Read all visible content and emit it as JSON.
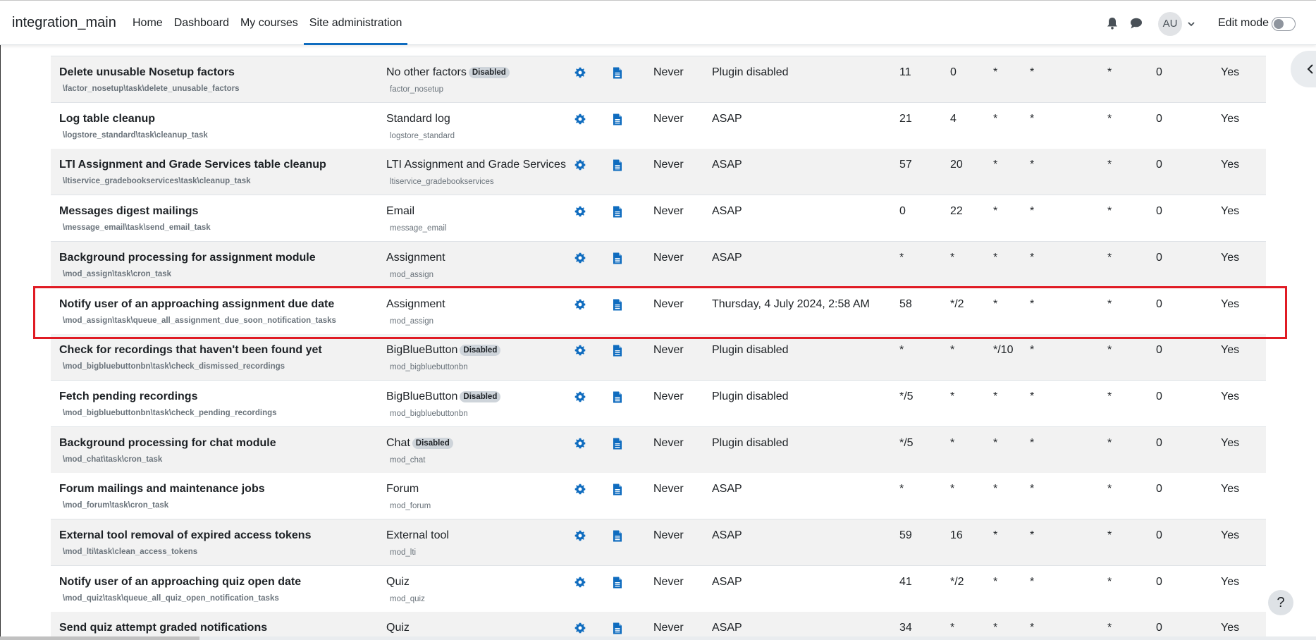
{
  "navbar": {
    "brand": "integration_main",
    "links": [
      "Home",
      "Dashboard",
      "My courses",
      "Site administration"
    ],
    "avatar_initials": "AU",
    "edit_mode_label": "Edit mode"
  },
  "help_label": "?",
  "colors": {
    "accent": "#0f6cbf",
    "highlight": "#e01b24",
    "badge": "#ced4da"
  },
  "rows": [
    {
      "name": "Delete unusable Nosetup factors",
      "classname": "\\factor_nosetup\\task\\delete_unusable_factors",
      "component": "No other factors",
      "badge": "Disabled",
      "plugin": "factor_nosetup",
      "lastrun": "Never",
      "nextrun": "Plugin disabled",
      "minute": "11",
      "hour": "0",
      "day": "*",
      "month": "*",
      "dow": "*",
      "faildelay": "0",
      "default": "Yes"
    },
    {
      "name": "Log table cleanup",
      "classname": "\\logstore_standard\\task\\cleanup_task",
      "component": "Standard log",
      "badge": "",
      "plugin": "logstore_standard",
      "lastrun": "Never",
      "nextrun": "ASAP",
      "minute": "21",
      "hour": "4",
      "day": "*",
      "month": "*",
      "dow": "*",
      "faildelay": "0",
      "default": "Yes"
    },
    {
      "name": "LTI Assignment and Grade Services table cleanup",
      "classname": "\\ltiservice_gradebookservices\\task\\cleanup_task",
      "component": "LTI Assignment and Grade Services",
      "badge": "",
      "plugin": "ltiservice_gradebookservices",
      "lastrun": "Never",
      "nextrun": "ASAP",
      "minute": "57",
      "hour": "20",
      "day": "*",
      "month": "*",
      "dow": "*",
      "faildelay": "0",
      "default": "Yes"
    },
    {
      "name": "Messages digest mailings",
      "classname": "\\message_email\\task\\send_email_task",
      "component": "Email",
      "badge": "",
      "plugin": "message_email",
      "lastrun": "Never",
      "nextrun": "ASAP",
      "minute": "0",
      "hour": "22",
      "day": "*",
      "month": "*",
      "dow": "*",
      "faildelay": "0",
      "default": "Yes"
    },
    {
      "name": "Background processing for assignment module",
      "classname": "\\mod_assign\\task\\cron_task",
      "component": "Assignment",
      "badge": "",
      "plugin": "mod_assign",
      "lastrun": "Never",
      "nextrun": "ASAP",
      "minute": "*",
      "hour": "*",
      "day": "*",
      "month": "*",
      "dow": "*",
      "faildelay": "0",
      "default": "Yes"
    },
    {
      "name": "Notify user of an approaching assignment due date",
      "classname": "\\mod_assign\\task\\queue_all_assignment_due_soon_notification_tasks",
      "component": "Assignment",
      "badge": "",
      "plugin": "mod_assign",
      "lastrun": "Never",
      "nextrun": "Thursday, 4 July 2024, 2:58 AM",
      "minute": "58",
      "hour": "*/2",
      "day": "*",
      "month": "*",
      "dow": "*",
      "faildelay": "0",
      "default": "Yes"
    },
    {
      "name": "Check for recordings that haven't been found yet",
      "classname": "\\mod_bigbluebuttonbn\\task\\check_dismissed_recordings",
      "component": "BigBlueButton",
      "badge": "Disabled",
      "plugin": "mod_bigbluebuttonbn",
      "lastrun": "Never",
      "nextrun": "Plugin disabled",
      "minute": "*",
      "hour": "*",
      "day": "*/10",
      "month": "*",
      "dow": "*",
      "faildelay": "0",
      "default": "Yes"
    },
    {
      "name": "Fetch pending recordings",
      "classname": "\\mod_bigbluebuttonbn\\task\\check_pending_recordings",
      "component": "BigBlueButton",
      "badge": "Disabled",
      "plugin": "mod_bigbluebuttonbn",
      "lastrun": "Never",
      "nextrun": "Plugin disabled",
      "minute": "*/5",
      "hour": "*",
      "day": "*",
      "month": "*",
      "dow": "*",
      "faildelay": "0",
      "default": "Yes"
    },
    {
      "name": "Background processing for chat module",
      "classname": "\\mod_chat\\task\\cron_task",
      "component": "Chat",
      "badge": "Disabled",
      "plugin": "mod_chat",
      "lastrun": "Never",
      "nextrun": "Plugin disabled",
      "minute": "*/5",
      "hour": "*",
      "day": "*",
      "month": "*",
      "dow": "*",
      "faildelay": "0",
      "default": "Yes"
    },
    {
      "name": "Forum mailings and maintenance jobs",
      "classname": "\\mod_forum\\task\\cron_task",
      "component": "Forum",
      "badge": "",
      "plugin": "mod_forum",
      "lastrun": "Never",
      "nextrun": "ASAP",
      "minute": "*",
      "hour": "*",
      "day": "*",
      "month": "*",
      "dow": "*",
      "faildelay": "0",
      "default": "Yes"
    },
    {
      "name": "External tool removal of expired access tokens",
      "classname": "\\mod_lti\\task\\clean_access_tokens",
      "component": "External tool",
      "badge": "",
      "plugin": "mod_lti",
      "lastrun": "Never",
      "nextrun": "ASAP",
      "minute": "59",
      "hour": "16",
      "day": "*",
      "month": "*",
      "dow": "*",
      "faildelay": "0",
      "default": "Yes"
    },
    {
      "name": "Notify user of an approaching quiz open date",
      "classname": "\\mod_quiz\\task\\queue_all_quiz_open_notification_tasks",
      "component": "Quiz",
      "badge": "",
      "plugin": "mod_quiz",
      "lastrun": "Never",
      "nextrun": "ASAP",
      "minute": "41",
      "hour": "*/2",
      "day": "*",
      "month": "*",
      "dow": "*",
      "faildelay": "0",
      "default": "Yes"
    },
    {
      "name": "Send quiz attempt graded notifications",
      "classname": "",
      "component": "Quiz",
      "badge": "",
      "plugin": "",
      "lastrun": "Never",
      "nextrun": "ASAP",
      "minute": "34",
      "hour": "*",
      "day": "*",
      "month": "*",
      "dow": "*",
      "faildelay": "0",
      "default": "Yes"
    }
  ]
}
